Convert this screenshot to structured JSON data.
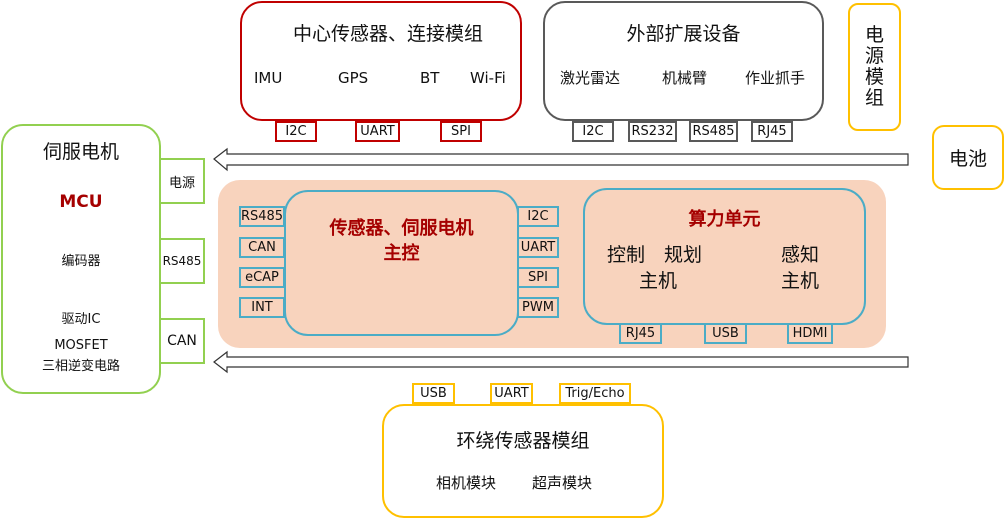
{
  "sensor_hub": {
    "title": "中心传感器、连接模组",
    "items": [
      "IMU",
      "GPS",
      "BT",
      "Wi-Fi"
    ],
    "ports": [
      "I2C",
      "UART",
      "SPI"
    ],
    "border_color": "#c00000"
  },
  "external_devices": {
    "title": "外部扩展设备",
    "items": [
      "激光雷达",
      "机械臂",
      "作业抓手"
    ],
    "ports": [
      "I2C",
      "RS232",
      "RS485",
      "RJ45"
    ],
    "border_color": "#595959"
  },
  "power_module": {
    "title": "电源模组",
    "border_color": "#ffc000"
  },
  "battery": {
    "title": "电池",
    "border_color": "#ffc000"
  },
  "servo_motor": {
    "title": "伺服电机",
    "mcu": "MCU",
    "encoder": "编码器",
    "driver_ic": "驱动IC",
    "mosfet": "MOSFET",
    "inverter": "三相逆变电路",
    "ports": [
      "电源",
      "RS485",
      "CAN"
    ],
    "border_color": "#92d050"
  },
  "main_board": {
    "background_color": "#f8d3bd",
    "controller": {
      "title_line1": "传感器、伺服电机",
      "title_line2": "主控",
      "left_ports": [
        "RS485",
        "CAN",
        "eCAP",
        "INT"
      ],
      "right_ports": [
        "I2C",
        "UART",
        "SPI",
        "PWM"
      ]
    },
    "compute_unit": {
      "title": "算力单元",
      "control_host_line1": "控制　规划",
      "control_host_line2": "主机",
      "perception_host_line1": "感知",
      "perception_host_line2": "主机",
      "ports": [
        "RJ45",
        "USB",
        "HDMI"
      ]
    },
    "accent_color": "#a50000",
    "border_color": "#4bacc6"
  },
  "env_sensors": {
    "title": "环绕传感器模组",
    "items": [
      "相机模块",
      "超声模块"
    ],
    "ports": [
      "USB",
      "UART",
      "Trig/Echo"
    ],
    "border_color": "#ffc000"
  },
  "arrows": [
    {
      "name": "power-bus-arrow",
      "direction": "left"
    },
    {
      "name": "lower-bus-arrow",
      "direction": "left"
    }
  ]
}
